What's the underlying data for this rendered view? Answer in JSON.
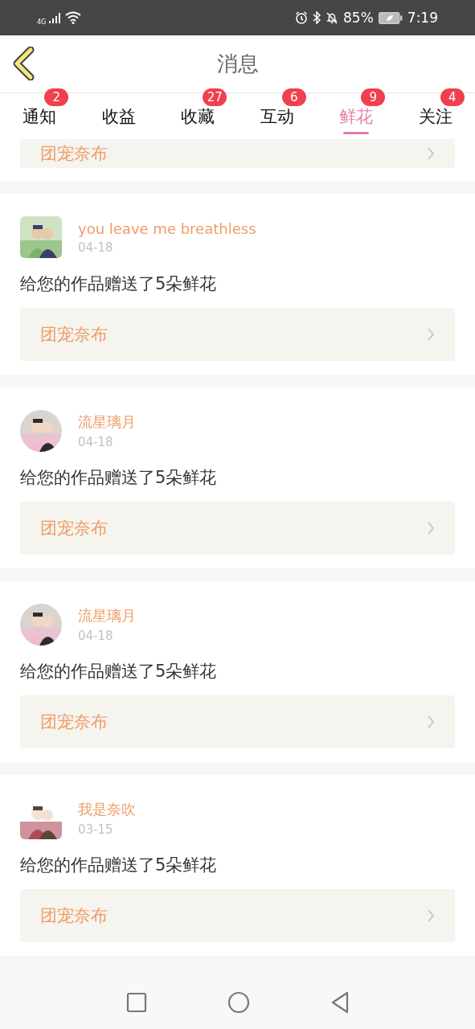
{
  "status_bar": {
    "network": "4G",
    "battery": "85%",
    "time": "7:19"
  },
  "header": {
    "title": "消息"
  },
  "tabs": [
    {
      "label": "通知",
      "badge": "2",
      "selected": false
    },
    {
      "label": "收益",
      "selected": false
    },
    {
      "label": "收藏",
      "badge": "27",
      "selected": false
    },
    {
      "label": "互动",
      "badge": "6",
      "selected": false
    },
    {
      "label": "鲜花",
      "badge": "9",
      "selected": true
    },
    {
      "label": "关注",
      "badge": "4",
      "selected": false
    }
  ],
  "partial_card": {
    "link": "团宠奈布"
  },
  "messages": [
    {
      "name": "you leave me breathless",
      "date": "04-18",
      "text": "给您的作品赠送了5朵鲜花",
      "link": "团宠奈布",
      "avatar": {
        "kind": "picture",
        "round": false
      }
    },
    {
      "name": "流星璃月",
      "date": "04-18",
      "text": "给您的作品赠送了5朵鲜花",
      "link": "团宠奈布",
      "avatar": {
        "kind": "picture",
        "round": true
      }
    },
    {
      "name": "流星璃月",
      "date": "04-18",
      "text": "给您的作品赠送了5朵鲜花",
      "link": "团宠奈布",
      "avatar": {
        "kind": "picture",
        "round": true
      }
    },
    {
      "name": "我是奈吹",
      "date": "03-15",
      "text": "给您的作品赠送了5朵鲜花",
      "link": "团宠奈布",
      "avatar": {
        "kind": "picture",
        "round": false
      }
    }
  ]
}
